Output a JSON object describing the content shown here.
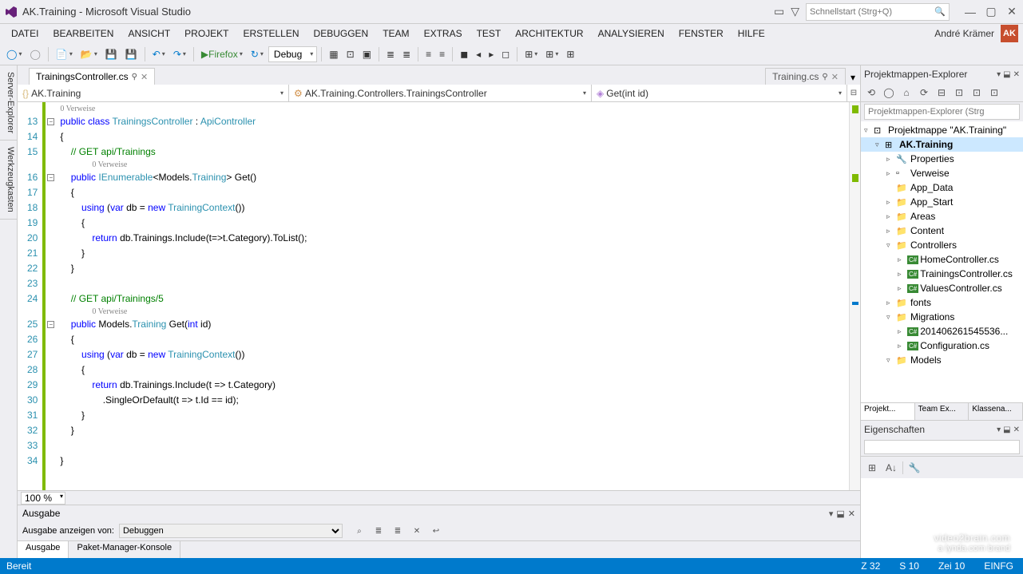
{
  "titlebar": {
    "title": "AK.Training - Microsoft Visual Studio",
    "search_placeholder": "Schnellstart (Strg+Q)"
  },
  "menubar": {
    "items": [
      "DATEI",
      "BEARBEITEN",
      "ANSICHT",
      "PROJEKT",
      "ERSTELLEN",
      "DEBUGGEN",
      "TEAM",
      "EXTRAS",
      "TEST",
      "ARCHITEKTUR",
      "ANALYSIEREN",
      "FENSTER",
      "HILFE"
    ],
    "user_name": "André Krämer",
    "user_initials": "AK"
  },
  "toolbar": {
    "browser": "Firefox",
    "config": "Debug"
  },
  "left_tabs": [
    "Server-Explorer",
    "Werkzeugkasten"
  ],
  "editor": {
    "tab_active": "TrainingsController.cs",
    "tab_inactive": "Training.cs",
    "nav_namespace": "AK.Training",
    "nav_class": "AK.Training.Controllers.TrainingsController",
    "nav_member": "Get(int id)",
    "zoom": "100 %",
    "references_label": "0 Verweise",
    "lines": [
      {
        "n": 13,
        "html": "<span class='kw'>public</span> <span class='kw'>class</span> <span class='type'>TrainingsController</span> : <span class='type'>ApiController</span>"
      },
      {
        "n": 14,
        "html": "{"
      },
      {
        "n": 15,
        "html": "    <span class='comment'>// GET api/Trainings</span>"
      },
      {
        "ref": true
      },
      {
        "n": 16,
        "html": "    <span class='kw'>public</span> <span class='type'>IEnumerable</span>&lt;Models.<span class='type'>Training</span>&gt; Get()"
      },
      {
        "n": 17,
        "html": "    {"
      },
      {
        "n": 18,
        "html": "        <span class='kw'>using</span> (<span class='kw'>var</span> db = <span class='kw'>new</span> <span class='type'>TrainingContext</span>())"
      },
      {
        "n": 19,
        "html": "        {"
      },
      {
        "n": 20,
        "html": "            <span class='kw'>return</span> db.Trainings.Include(t=&gt;t.Category).ToList();"
      },
      {
        "n": 21,
        "html": "        }"
      },
      {
        "n": 22,
        "html": "    }"
      },
      {
        "n": 23,
        "html": ""
      },
      {
        "n": 24,
        "html": "    <span class='comment'>// GET api/Trainings/5</span>"
      },
      {
        "ref": true
      },
      {
        "n": 25,
        "html": "    <span class='kw'>public</span> Models.<span class='type'>Training</span> Get(<span class='kw'>int</span> id)"
      },
      {
        "n": 26,
        "html": "    {"
      },
      {
        "n": 27,
        "html": "        <span class='kw'>using</span> (<span class='kw'>var</span> db = <span class='kw'>new</span> <span class='type'>TrainingContext</span>())"
      },
      {
        "n": 28,
        "html": "        {"
      },
      {
        "n": 29,
        "html": "            <span class='kw'>return</span> db.Trainings.Include(t =&gt; t.Category)"
      },
      {
        "n": 30,
        "html": "                .SingleOrDefault(t =&gt; t.Id == id);"
      },
      {
        "n": 31,
        "html": "        }"
      },
      {
        "n": 32,
        "html": "    }"
      },
      {
        "n": 33,
        "html": ""
      },
      {
        "n": 34,
        "html": "}"
      }
    ]
  },
  "output": {
    "title": "Ausgabe",
    "show_from_label": "Ausgabe anzeigen von:",
    "source": "Debuggen",
    "tabs": [
      "Ausgabe",
      "Paket-Manager-Konsole"
    ]
  },
  "solution_explorer": {
    "title": "Projektmappen-Explorer",
    "search_placeholder": "Projektmappen-Explorer (Strg",
    "tree": [
      {
        "level": 0,
        "arrow": "▿",
        "icon": "sln",
        "label": "Projektmappe \"AK.Training\"",
        "bold": false
      },
      {
        "level": 1,
        "arrow": "▿",
        "icon": "proj",
        "label": "AK.Training",
        "bold": true,
        "selected": true
      },
      {
        "level": 2,
        "arrow": "▹",
        "icon": "wrench",
        "label": "Properties"
      },
      {
        "level": 2,
        "arrow": "▹",
        "icon": "ref",
        "label": "Verweise"
      },
      {
        "level": 2,
        "arrow": "",
        "icon": "folder",
        "label": "App_Data"
      },
      {
        "level": 2,
        "arrow": "▹",
        "icon": "folder",
        "label": "App_Start"
      },
      {
        "level": 2,
        "arrow": "▹",
        "icon": "folder",
        "label": "Areas"
      },
      {
        "level": 2,
        "arrow": "▹",
        "icon": "folder",
        "label": "Content"
      },
      {
        "level": 2,
        "arrow": "▿",
        "icon": "folder",
        "label": "Controllers"
      },
      {
        "level": 3,
        "arrow": "▹",
        "icon": "cs",
        "label": "HomeController.cs"
      },
      {
        "level": 3,
        "arrow": "▹",
        "icon": "cs",
        "label": "TrainingsController.cs"
      },
      {
        "level": 3,
        "arrow": "▹",
        "icon": "cs",
        "label": "ValuesController.cs"
      },
      {
        "level": 2,
        "arrow": "▹",
        "icon": "folder",
        "label": "fonts"
      },
      {
        "level": 2,
        "arrow": "▿",
        "icon": "folder",
        "label": "Migrations"
      },
      {
        "level": 3,
        "arrow": "▹",
        "icon": "cs",
        "label": "201406261545536..."
      },
      {
        "level": 3,
        "arrow": "▹",
        "icon": "cs",
        "label": "Configuration.cs"
      },
      {
        "level": 2,
        "arrow": "▿",
        "icon": "folder",
        "label": "Models"
      }
    ],
    "bottom_tabs": [
      "Projekt...",
      "Team Ex...",
      "Klassena..."
    ]
  },
  "properties": {
    "title": "Eigenschaften"
  },
  "statusbar": {
    "ready": "Bereit",
    "line": "Z 32",
    "col": "S 10",
    "ch": "Zei 10",
    "ins": "EINFG"
  },
  "watermark": {
    "line1": "video2brain.com",
    "line2": "a lynda.com brand"
  }
}
